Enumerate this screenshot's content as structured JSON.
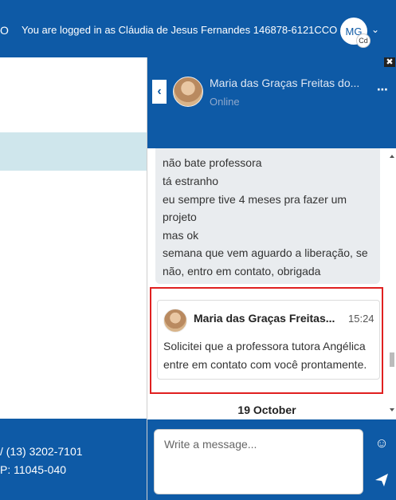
{
  "header": {
    "edge_glyph": "O",
    "login_text": "You are logged in as Cláudia de Jesus Fernandes 146878-6121CCO",
    "avatar_initials": "MG",
    "avatar_badge": "Cd",
    "menu_caret": "⌄"
  },
  "left_footer": {
    "line1": "/ (13) 3202-7101",
    "line2": "P: 11045-040"
  },
  "drawer": {
    "close_label": "✖",
    "back_label": "‹",
    "contact_name": "Maria das Graças Freitas do...",
    "contact_status": "Online",
    "menu_label": "⋯",
    "previous_lines": [
      "não bate professora",
      "tá estranho",
      "eu sempre tive 4 meses pra fazer um",
      "projeto",
      "mas ok",
      "semana que vem aguardo a liberação, se",
      "não, entro em contato, obrigada"
    ],
    "message": {
      "sender": "Maria das Graças Freitas...",
      "time": "15:24",
      "lines": [
        "Solicitei que a professora tutora Angélica",
        "entre em contato com você prontamente."
      ]
    },
    "date_separator": "19 October",
    "composer": {
      "placeholder": "Write a message...",
      "emoji_icon": "☺"
    }
  },
  "colors": {
    "brand": "#0e5aa6",
    "highlight": "#e02020",
    "bubble": "#e9ecef"
  }
}
